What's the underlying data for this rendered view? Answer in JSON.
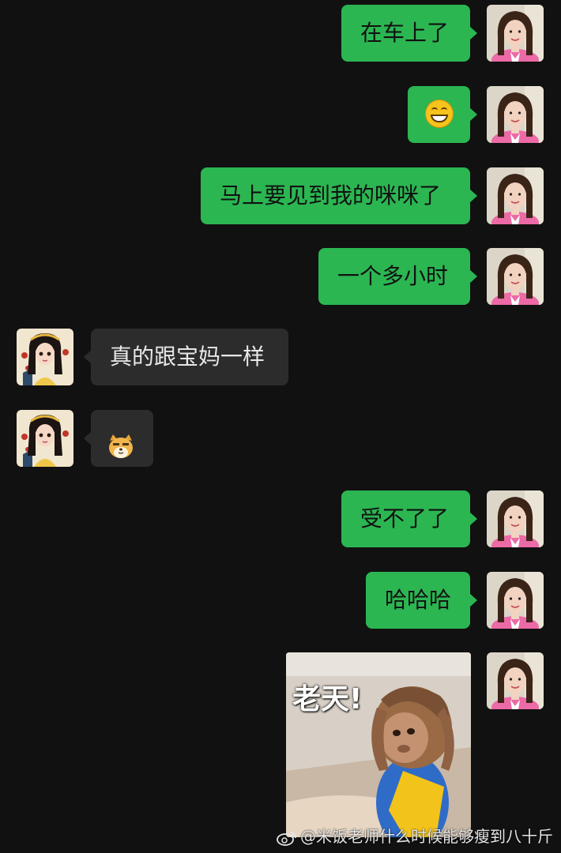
{
  "messages": [
    {
      "side": "out",
      "text": "在车上了"
    },
    {
      "side": "out",
      "emoji": "grin-emoji"
    },
    {
      "side": "out",
      "text": "马上要见到我的咪咪了"
    },
    {
      "side": "out",
      "text": "一个多小时"
    },
    {
      "side": "in",
      "text": "真的跟宝妈一样"
    },
    {
      "side": "in",
      "emoji": "doge-emoji"
    },
    {
      "side": "out",
      "text": "受不了了"
    },
    {
      "side": "out",
      "text": "哈哈哈"
    },
    {
      "side": "out",
      "image_caption": "老天!"
    }
  ],
  "watermark": "@米饭老师什么时候能够瘦到八十斤",
  "colors": {
    "background": "#111111",
    "outgoing_bubble": "#2bb652",
    "incoming_bubble": "#2c2c2c"
  }
}
